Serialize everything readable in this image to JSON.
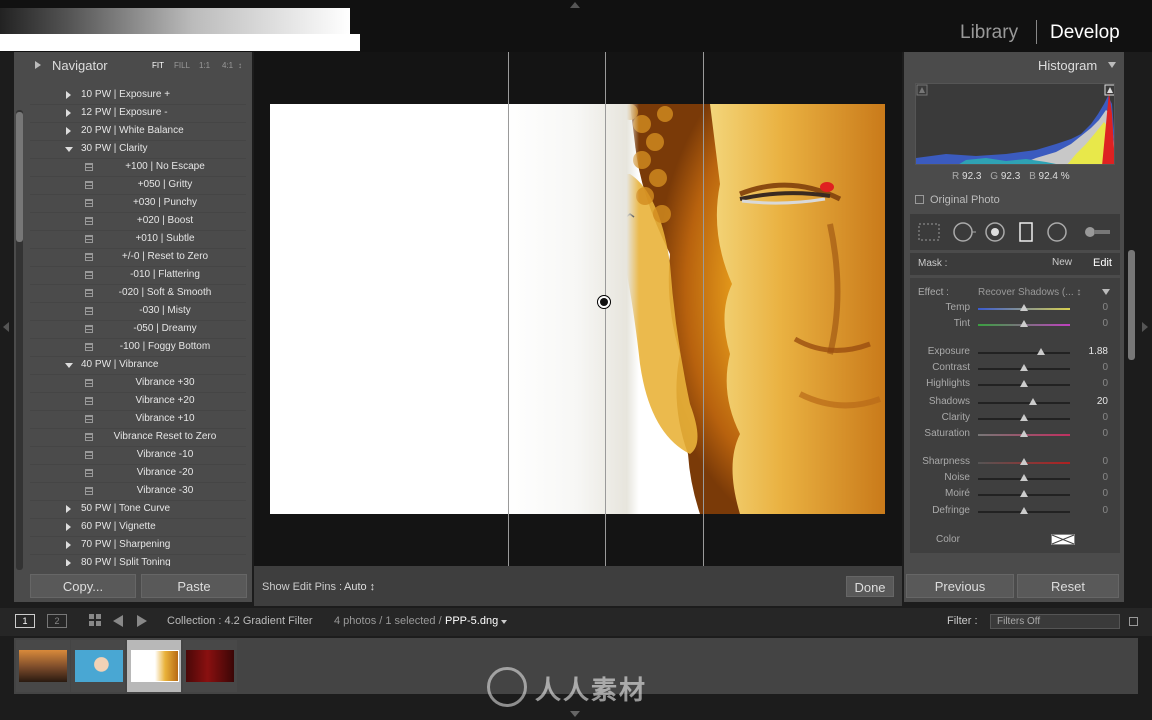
{
  "header": {
    "modules": [
      "Library",
      "Develop"
    ],
    "active_module": "Develop"
  },
  "navigator": {
    "title": "Navigator",
    "zoom_options": [
      "FIT",
      "FILL",
      "1:1",
      "4:1"
    ],
    "zoom_options_more": "↕"
  },
  "presets": [
    {
      "label": "10 PW | Exposure +",
      "kind": "folder",
      "open": false
    },
    {
      "label": "12 PW | Exposure -",
      "kind": "folder",
      "open": false
    },
    {
      "label": "20 PW | White Balance",
      "kind": "folder",
      "open": false
    },
    {
      "label": "30 PW | Clarity",
      "kind": "folder",
      "open": true
    },
    {
      "label": "+100 | No Escape",
      "kind": "preset"
    },
    {
      "label": "+050 | Gritty",
      "kind": "preset"
    },
    {
      "label": "+030 | Punchy",
      "kind": "preset"
    },
    {
      "label": "+020 | Boost",
      "kind": "preset"
    },
    {
      "label": "+010 | Subtle",
      "kind": "preset"
    },
    {
      "label": "+/-0 | Reset to Zero",
      "kind": "preset"
    },
    {
      "label": "-010 | Flattering",
      "kind": "preset"
    },
    {
      "label": "-020 | Soft & Smooth",
      "kind": "preset"
    },
    {
      "label": "-030 | Misty",
      "kind": "preset"
    },
    {
      "label": "-050 | Dreamy",
      "kind": "preset"
    },
    {
      "label": "-100 | Foggy Bottom",
      "kind": "preset"
    },
    {
      "label": "40 PW | Vibrance",
      "kind": "folder",
      "open": true
    },
    {
      "label": "Vibrance +30",
      "kind": "preset"
    },
    {
      "label": "Vibrance +20",
      "kind": "preset"
    },
    {
      "label": "Vibrance +10",
      "kind": "preset"
    },
    {
      "label": "Vibrance Reset to Zero",
      "kind": "preset"
    },
    {
      "label": "Vibrance -10",
      "kind": "preset"
    },
    {
      "label": "Vibrance -20",
      "kind": "preset"
    },
    {
      "label": "Vibrance -30",
      "kind": "preset"
    },
    {
      "label": "50 PW | Tone Curve",
      "kind": "folder",
      "open": false
    },
    {
      "label": "60 PW | Vignette",
      "kind": "folder",
      "open": false
    },
    {
      "label": "70 PW | Sharpening",
      "kind": "folder",
      "open": false
    },
    {
      "label": "80 PW | Split Toning",
      "kind": "folder",
      "open": false
    }
  ],
  "left_buttons": {
    "copy": "Copy...",
    "paste": "Paste"
  },
  "toolbar": {
    "show_edit_pins_label": "Show Edit Pins :",
    "show_edit_pins_value": "Auto ↕",
    "done": "Done"
  },
  "histogram": {
    "title": "Histogram",
    "r_label": "R",
    "r": "92.3",
    "g_label": "G",
    "g": "92.3",
    "b_label": "B",
    "b": "92.4",
    "unit": "%",
    "original_photo": "Original Photo"
  },
  "mask": {
    "label": "Mask :",
    "new": "New",
    "edit": "Edit"
  },
  "effect": {
    "label": "Effect :",
    "value": "Recover Shadows (... ↕"
  },
  "sliders": [
    {
      "label": "Temp",
      "value": "0",
      "pos": 0.5,
      "active": false,
      "track": "temp"
    },
    {
      "label": "Tint",
      "value": "0",
      "pos": 0.5,
      "active": false,
      "track": "tint"
    },
    {
      "label": "Exposure",
      "value": "1.88",
      "pos": 0.69,
      "active": true,
      "track": "plain"
    },
    {
      "label": "Contrast",
      "value": "0",
      "pos": 0.5,
      "active": false,
      "track": "plain"
    },
    {
      "label": "Highlights",
      "value": "0",
      "pos": 0.5,
      "active": false,
      "track": "plain"
    },
    {
      "label": "Shadows",
      "value": "20",
      "pos": 0.6,
      "active": true,
      "track": "plain"
    },
    {
      "label": "Clarity",
      "value": "0",
      "pos": 0.5,
      "active": false,
      "track": "plain"
    },
    {
      "label": "Saturation",
      "value": "0",
      "pos": 0.5,
      "active": false,
      "track": "sat"
    },
    {
      "label": "Sharpness",
      "value": "0",
      "pos": 0.5,
      "active": false,
      "track": "red"
    },
    {
      "label": "Noise",
      "value": "0",
      "pos": 0.5,
      "active": false,
      "track": "plain"
    },
    {
      "label": "Moiré",
      "value": "0",
      "pos": 0.5,
      "active": false,
      "track": "plain"
    },
    {
      "label": "Defringe",
      "value": "0",
      "pos": 0.5,
      "active": false,
      "track": "plain"
    }
  ],
  "color": {
    "label": "Color",
    "swatch": "#ffffff"
  },
  "right_buttons": {
    "previous": "Previous",
    "reset": "Reset"
  },
  "filmbar": {
    "page1": "1",
    "page2": "2",
    "collection": "Collection : 4.2 Gradient Filter",
    "photos": "4 photos / 1 selected /",
    "file": "PPP-5.dng",
    "filter_label": "Filter :",
    "filter_value": "Filters Off"
  },
  "filmstrip": {
    "selected_index": 2,
    "count": 4
  },
  "watermark": {
    "text": "人人素材"
  },
  "colors": {
    "accent_active": "#ffffff",
    "panel": "#4b4b4b",
    "background": "#1c1c1c",
    "mask_pin_red": "#e02020"
  }
}
